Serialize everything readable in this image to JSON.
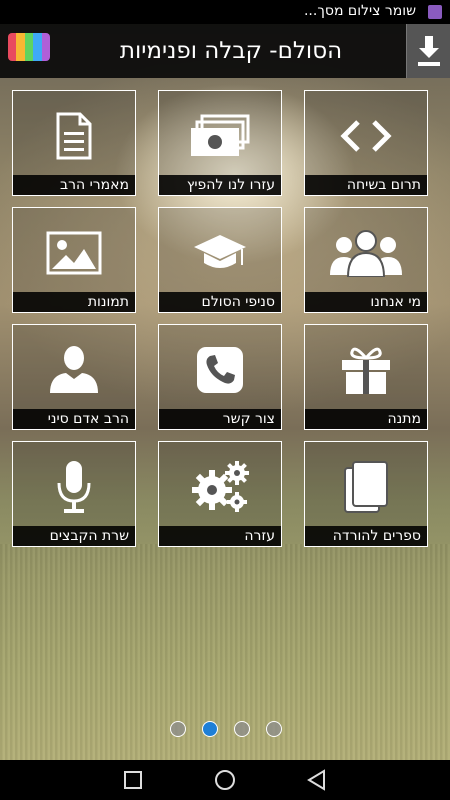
{
  "status_bar": {
    "notification_text": "שומר צילום מסך..."
  },
  "header": {
    "title": "הסולם- קבלה ופנימיות",
    "logo_colors": [
      "#e84a5f",
      "#f7b733",
      "#5fd35f",
      "#3fa9f5",
      "#b05fd8"
    ]
  },
  "tiles": [
    {
      "label": "תרום בשיחה",
      "icon": "code-brackets-icon"
    },
    {
      "label": "עזרו לנו להפיץ",
      "icon": "money-icon"
    },
    {
      "label": "מאמרי הרב",
      "icon": "document-icon"
    },
    {
      "label": "מי אנחנו",
      "icon": "group-icon"
    },
    {
      "label": "סניפי הסולם",
      "icon": "graduation-cap-icon"
    },
    {
      "label": "תמונות",
      "icon": "image-icon"
    },
    {
      "label": "מתנה",
      "icon": "gift-icon"
    },
    {
      "label": "צור קשר",
      "icon": "phone-icon"
    },
    {
      "label": "הרב אדם סיני",
      "icon": "person-icon"
    },
    {
      "label": "ספרים להורדה",
      "icon": "books-icon"
    },
    {
      "label": "עזרה",
      "icon": "gears-icon"
    },
    {
      "label": "שרת הקבצים",
      "icon": "microphone-icon"
    }
  ],
  "pager": {
    "total": 4,
    "active": 2,
    "active_color": "#1e7fd6"
  }
}
